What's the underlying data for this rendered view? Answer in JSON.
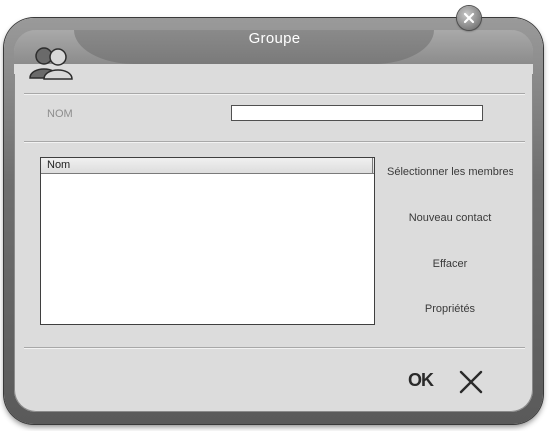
{
  "window": {
    "title": "Groupe"
  },
  "form": {
    "name_label": "NOM",
    "name_value": ""
  },
  "members_list": {
    "columns": [
      "Nom"
    ],
    "rows": []
  },
  "actions": {
    "select_members": "Sélectionner les membres",
    "new_contact": "Nouveau contact",
    "delete": "Effacer",
    "properties": "Propriétés"
  },
  "footer": {
    "ok_label": "OK"
  },
  "icons": {
    "close": "close-icon",
    "app": "group-users-icon",
    "cancel": "cancel-x-icon"
  }
}
